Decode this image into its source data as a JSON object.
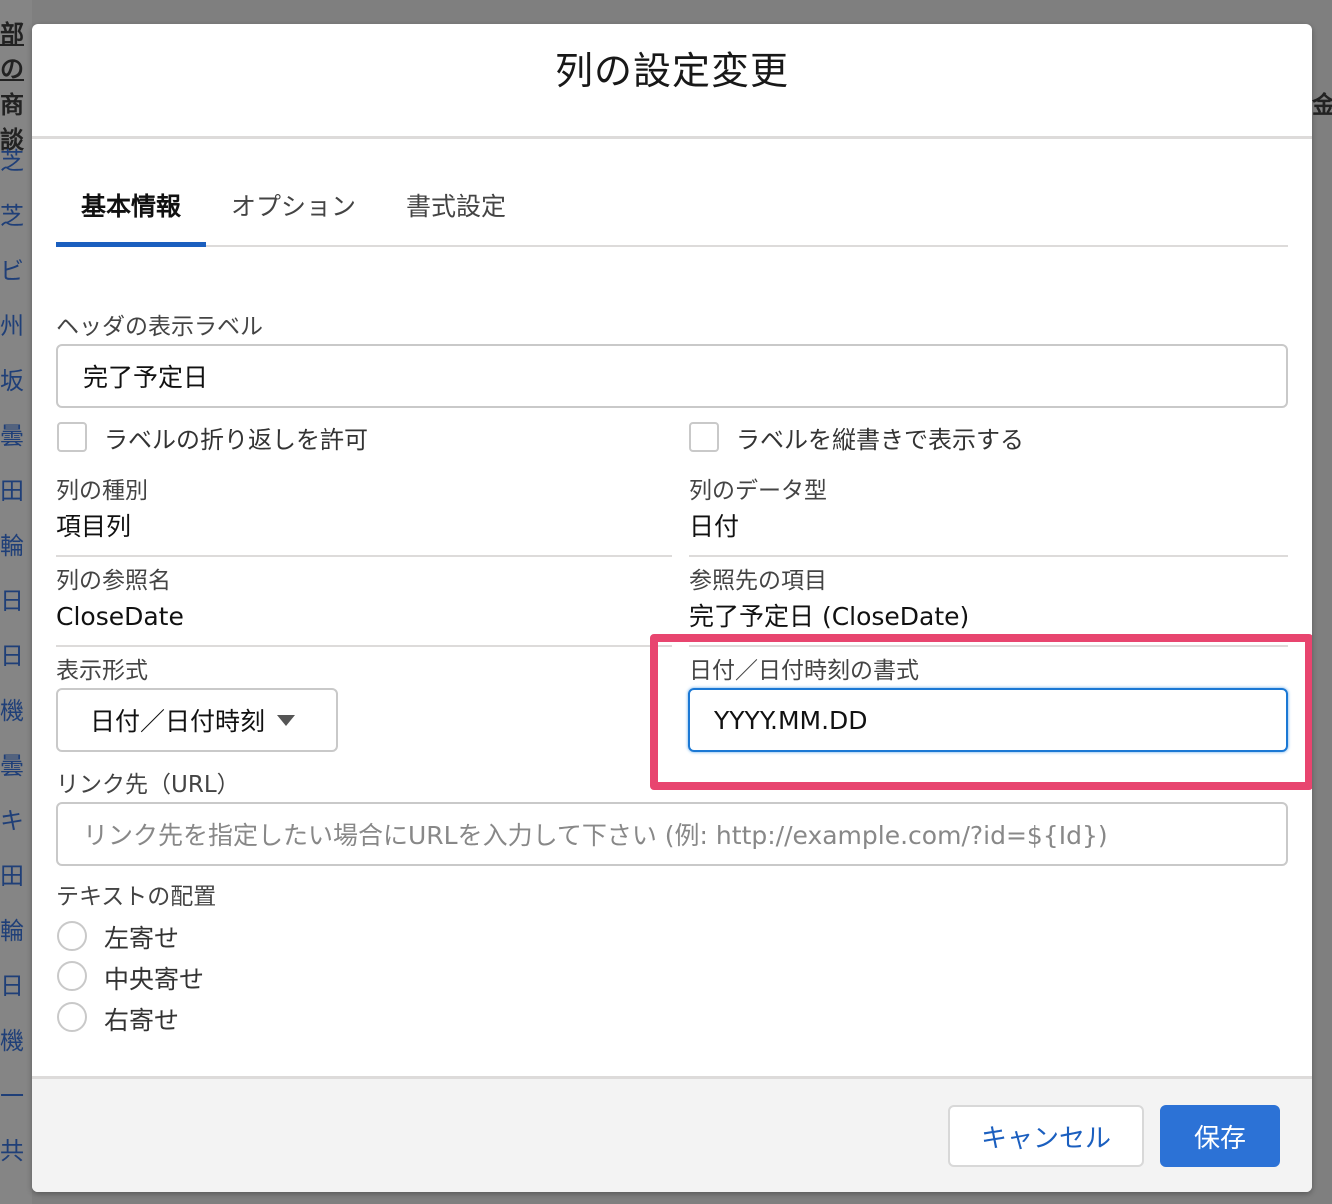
{
  "background": {
    "top_heading": "部の",
    "left_heading": "商談",
    "right_heading": "金",
    "rows": [
      "芝",
      "芝",
      "ビ",
      "州",
      "坂",
      "曇",
      "田",
      "輪",
      "日",
      "日",
      "機",
      "曇",
      "キ",
      "田",
      "輪",
      "日",
      "機",
      "一",
      "共"
    ]
  },
  "modal": {
    "title": "列の設定変更",
    "tabs": [
      {
        "label": "基本情報",
        "active": true
      },
      {
        "label": "オプション",
        "active": false
      },
      {
        "label": "書式設定",
        "active": false
      }
    ],
    "header_label": {
      "label": "ヘッダの表示ラベル",
      "value": "完了予定日"
    },
    "checkbox_wrap": {
      "label": "ラベルの折り返しを許可",
      "checked": false
    },
    "checkbox_vertical": {
      "label": "ラベルを縦書きで表示する",
      "checked": false
    },
    "column_type": {
      "label": "列の種別",
      "value": "項目列"
    },
    "data_type": {
      "label": "列のデータ型",
      "value": "日付"
    },
    "reference_name": {
      "label": "列の参照名",
      "value": "CloseDate"
    },
    "reference_field": {
      "label": "参照先の項目",
      "value": "完了予定日 (CloseDate)"
    },
    "display_format": {
      "label": "表示形式",
      "value": "日付／日付時刻"
    },
    "date_format": {
      "label": "日付／日付時刻の書式",
      "value": "YYYY.MM.DD"
    },
    "link_url": {
      "label": "リンク先（URL）",
      "placeholder": "リンク先を指定したい場合にURLを入力して下さい (例: http://example.com/?id=${Id})"
    },
    "text_align": {
      "label": "テキストの配置",
      "options": [
        "左寄せ",
        "中央寄せ",
        "右寄せ"
      ]
    },
    "footer": {
      "cancel_label": "キャンセル",
      "save_label": "保存"
    },
    "colors": {
      "highlight": "#e8456f",
      "accent": "#2c72d6"
    }
  }
}
